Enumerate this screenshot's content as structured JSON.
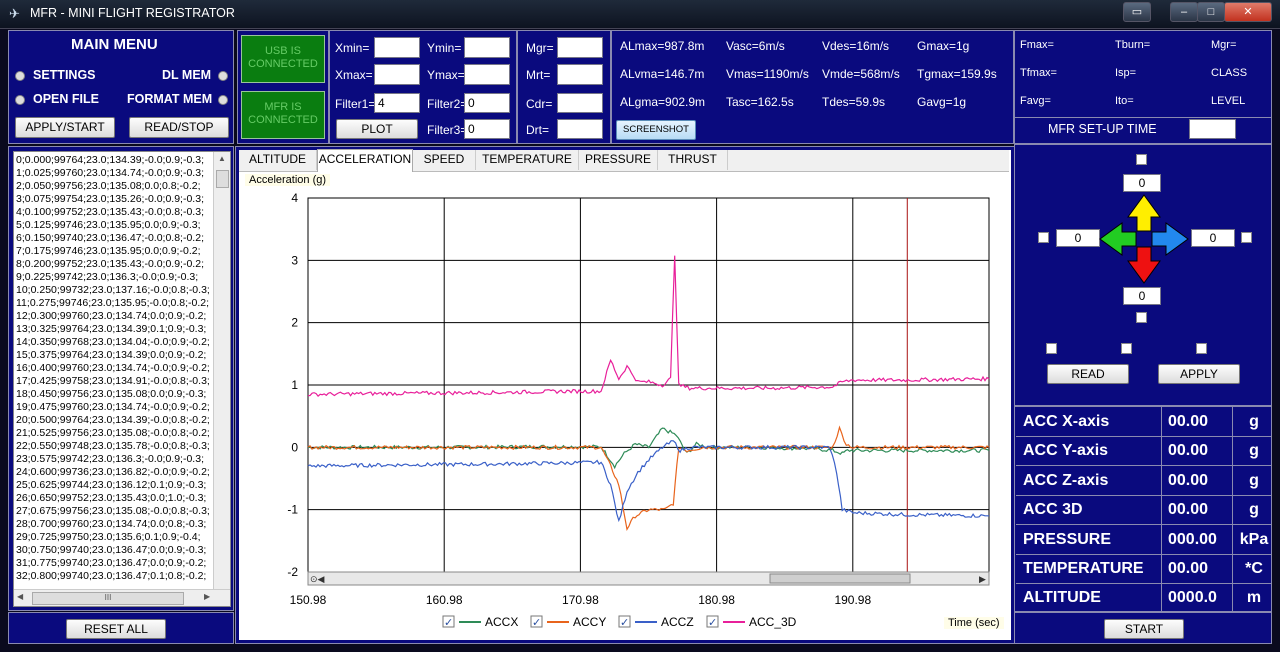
{
  "window": {
    "title": "MFR - MINI FLIGHT REGISTRATOR"
  },
  "menu": {
    "title": "MAIN MENU",
    "settings": "SETTINGS",
    "dl_mem": "DL MEM",
    "open_file": "OPEN FILE",
    "format_mem": "FORMAT MEM",
    "apply_start": "APPLY/START",
    "read_stop": "READ/STOP"
  },
  "status": {
    "usb": "USB IS CONNECTED",
    "mfr": "MFR IS CONNECTED"
  },
  "plot_inputs": {
    "xmin_label": "Xmin=",
    "ymin_label": "Ymin=",
    "xmax_label": "Xmax=",
    "ymax_label": "Ymax=",
    "filter1_label": "Filter1=",
    "filter1_value": "4",
    "filter2_label": "Filter2=",
    "filter2_value": "0",
    "filter3_label": "Filter3=",
    "filter3_value": "0",
    "plot_button": "PLOT"
  },
  "mass_inputs": {
    "mgr": "Mgr=",
    "mrt": "Mrt=",
    "cdr": "Cdr=",
    "drt": "Drt="
  },
  "stats": {
    "r1": [
      "ALmax=987.8m",
      "Vasc=6m/s",
      "Vdes=16m/s",
      "Gmax=1g"
    ],
    "r2": [
      "ALvma=146.7m",
      "Vmas=1190m/s",
      "Vmde=568m/s",
      "Tgmax=159.9s"
    ],
    "r3": [
      "ALgma=902.9m",
      "Tasc=162.5s",
      "Tdes=59.9s",
      "Gavg=1g"
    ],
    "screenshot": "SCREENSHOT"
  },
  "motor": {
    "r1": [
      "Fmax=",
      "Tburn=",
      "Mgr="
    ],
    "r2": [
      "Tfmax=",
      "Isp=",
      "CLASS"
    ],
    "r3": [
      "Favg=",
      "Ito=",
      "LEVEL"
    ],
    "setup_time": "MFR SET-UP TIME"
  },
  "log": [
    "0;0.000;99764;23.0;134.39;-0.0;0.9;-0.3;",
    "1;0.025;99760;23.0;134.74;-0.0;0.9;-0.3;",
    "2;0.050;99756;23.0;135.08;0.0;0.8;-0.2;",
    "3;0.075;99754;23.0;135.26;-0.0;0.9;-0.3;",
    "4;0.100;99752;23.0;135.43;-0.0;0.8;-0.3;",
    "5;0.125;99746;23.0;135.95;0.0;0.9;-0.3;",
    "6;0.150;99740;23.0;136.47;-0.0;0.8;-0.2;",
    "7;0.175;99746;23.0;135.95;0.0;0.9;-0.2;",
    "8;0.200;99752;23.0;135.43;-0.0;0.9;-0.2;",
    "9;0.225;99742;23.0;136.3;-0.0;0.9;-0.3;",
    "10;0.250;99732;23.0;137.16;-0.0;0.8;-0.3;",
    "11;0.275;99746;23.0;135.95;-0.0;0.8;-0.2;",
    "12;0.300;99760;23.0;134.74;0.0;0.9;-0.2;",
    "13;0.325;99764;23.0;134.39;0.1;0.9;-0.3;",
    "14;0.350;99768;23.0;134.04;-0.0;0.9;-0.2;",
    "15;0.375;99764;23.0;134.39;0.0;0.9;-0.2;",
    "16;0.400;99760;23.0;134.74;-0.0;0.9;-0.2;",
    "17;0.425;99758;23.0;134.91;-0.0;0.8;-0.3;",
    "18;0.450;99756;23.0;135.08;0.0;0.9;-0.3;",
    "19;0.475;99760;23.0;134.74;-0.0;0.9;-0.2;",
    "20;0.500;99764;23.0;134.39;-0.0;0.8;-0.2;",
    "21;0.525;99756;23.0;135.08;-0.0;0.8;-0.2;",
    "22;0.550;99748;23.0;135.78;-0.0;0.8;-0.3;",
    "23;0.575;99742;23.0;136.3;-0.0;0.9;-0.3;",
    "24;0.600;99736;23.0;136.82;-0.0;0.9;-0.2;",
    "25;0.625;99744;23.0;136.12;0.1;0.9;-0.3;",
    "26;0.650;99752;23.0;135.43;0.0;1.0;-0.3;",
    "27;0.675;99756;23.0;135.08;-0.0;0.8;-0.3;",
    "28;0.700;99760;23.0;134.74;0.0;0.8;-0.3;",
    "29;0.725;99750;23.0;135.6;0.1;0.9;-0.4;",
    "30;0.750;99740;23.0;136.47;0.0;0.9;-0.3;",
    "31;0.775;99740;23.0;136.47;0.0;0.9;-0.2;",
    "32;0.800;99740;23.0;136.47;0.1;0.8;-0.2;"
  ],
  "reset_all": "RESET ALL",
  "tabs": [
    "ALTITUDE",
    "ACCELERATION",
    "SPEED",
    "TEMPERATURE",
    "PRESSURE",
    "THRUST"
  ],
  "active_tab": "ACCELERATION",
  "orient": {
    "top": "0",
    "left": "0",
    "right": "0",
    "bottom": "0",
    "read": "READ",
    "apply": "APPLY"
  },
  "readouts": [
    {
      "label": "ACC X-axis",
      "value": "00.00",
      "unit": "g"
    },
    {
      "label": "ACC Y-axis",
      "value": "00.00",
      "unit": "g"
    },
    {
      "label": "ACC Z-axis",
      "value": "00.00",
      "unit": "g"
    },
    {
      "label": "ACC 3D",
      "value": "00.00",
      "unit": "g"
    },
    {
      "label": "PRESSURE",
      "value": "000.00",
      "unit": "kPa"
    },
    {
      "label": "TEMPERATURE",
      "value": "00.00",
      "unit": "*C"
    },
    {
      "label": "ALTITUDE",
      "value": "0000.0",
      "unit": "m"
    }
  ],
  "start": "START",
  "chart_data": {
    "type": "line",
    "title": "",
    "ylabel": "Acceleration (g)",
    "xlabel": "Time (sec)",
    "xlim": [
      150.98,
      200.98
    ],
    "ylim": [
      -2,
      4
    ],
    "xticks": [
      "150.98",
      "160.98",
      "170.98",
      "180.98",
      "190.98"
    ],
    "yticks": [
      "4",
      "3",
      "2",
      "1",
      "0",
      "-1",
      "-2"
    ],
    "grid": true,
    "marker_x": 194.98,
    "legend": [
      "ACCX",
      "ACCY",
      "ACCZ",
      "ACC_3D"
    ],
    "colors": {
      "ACCX": "#2e8b57",
      "ACCY": "#e8641c",
      "ACCZ": "#3a60c8",
      "ACC_3D": "#e8209a"
    },
    "series": [
      {
        "name": "ACCX",
        "points": [
          [
            150.98,
            0.0
          ],
          [
            156,
            0.0
          ],
          [
            162,
            0.0
          ],
          [
            168,
            0.01
          ],
          [
            172.5,
            0.01
          ],
          [
            173.5,
            -0.3
          ],
          [
            174.2,
            -0.1
          ],
          [
            175,
            0.05
          ],
          [
            176,
            0.0
          ],
          [
            177,
            0.3
          ],
          [
            178,
            0.2
          ],
          [
            178.8,
            -0.1
          ],
          [
            179.5,
            0.05
          ],
          [
            180.5,
            0.0
          ],
          [
            184,
            0.0
          ],
          [
            188,
            -0.02
          ],
          [
            189.5,
            -0.05
          ],
          [
            190.2,
            -0.1
          ],
          [
            190.6,
            -0.05
          ],
          [
            195,
            -0.05
          ],
          [
            200.98,
            -0.05
          ]
        ]
      },
      {
        "name": "ACCY",
        "points": [
          [
            150.98,
            0.0
          ],
          [
            160,
            0.0
          ],
          [
            168,
            0.0
          ],
          [
            172.5,
            0.0
          ],
          [
            173.2,
            -0.3
          ],
          [
            173.8,
            -0.6
          ],
          [
            174.4,
            -1.3
          ],
          [
            175,
            -1.1
          ],
          [
            176,
            -1.0
          ],
          [
            177.2,
            -1.0
          ],
          [
            177.8,
            -0.9
          ],
          [
            178.2,
            0.0
          ],
          [
            178.8,
            -0.05
          ],
          [
            180,
            0.0
          ],
          [
            189.5,
            0.0
          ],
          [
            190.0,
            0.3
          ],
          [
            190.5,
            0.05
          ],
          [
            191,
            0.0
          ],
          [
            200.98,
            0.0
          ]
        ]
      },
      {
        "name": "ACCZ",
        "points": [
          [
            150.98,
            -0.3
          ],
          [
            158,
            -0.28
          ],
          [
            164,
            -0.27
          ],
          [
            170,
            -0.25
          ],
          [
            172.5,
            -0.24
          ],
          [
            173.2,
            -0.6
          ],
          [
            173.8,
            -1.2
          ],
          [
            174.4,
            -0.7
          ],
          [
            175.2,
            -0.4
          ],
          [
            176,
            -0.2
          ],
          [
            177,
            0.0
          ],
          [
            177.8,
            0.1
          ],
          [
            178.3,
            -0.05
          ],
          [
            179,
            0.0
          ],
          [
            189.3,
            0.0
          ],
          [
            189.8,
            -0.4
          ],
          [
            190.2,
            -1.0
          ],
          [
            191,
            -1.05
          ],
          [
            195,
            -1.08
          ],
          [
            200.98,
            -1.1
          ]
        ]
      },
      {
        "name": "ACC_3D",
        "points": [
          [
            150.98,
            0.85
          ],
          [
            155,
            0.86
          ],
          [
            160,
            0.87
          ],
          [
            165,
            0.88
          ],
          [
            170,
            0.9
          ],
          [
            172.5,
            0.9
          ],
          [
            173.2,
            1.4
          ],
          [
            173.8,
            1.1
          ],
          [
            174.4,
            1.3
          ],
          [
            175.2,
            1.05
          ],
          [
            176,
            1.05
          ],
          [
            177,
            1.0
          ],
          [
            177.6,
            1.1
          ],
          [
            177.9,
            3.1
          ],
          [
            178.2,
            1.0
          ],
          [
            179,
            0.95
          ],
          [
            185,
            0.95
          ],
          [
            189.5,
            0.97
          ],
          [
            190.2,
            1.05
          ],
          [
            191,
            1.08
          ],
          [
            195,
            1.08
          ],
          [
            200.98,
            1.1
          ]
        ]
      }
    ]
  }
}
